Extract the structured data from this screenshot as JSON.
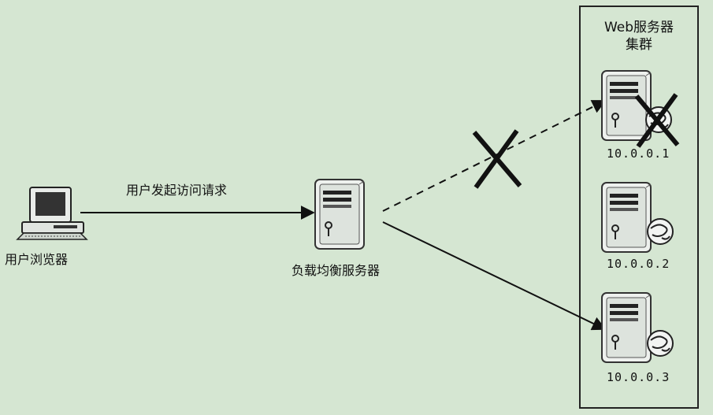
{
  "diagram": {
    "request_label": "用户发起访问请求",
    "browser_label": "用户浏览器",
    "load_balancer_label": "负载均衡服务器",
    "cluster": {
      "title_line1": "Web服务器",
      "title_line2": "集群",
      "servers": [
        {
          "ip": "10.0.0.1",
          "status": "failed"
        },
        {
          "ip": "10.0.0.2",
          "status": "ok"
        },
        {
          "ip": "10.0.0.3",
          "status": "ok"
        }
      ]
    }
  },
  "colors": {
    "background": "#d5e6d2",
    "line": "#111111",
    "server_body": "#e8ece8"
  }
}
